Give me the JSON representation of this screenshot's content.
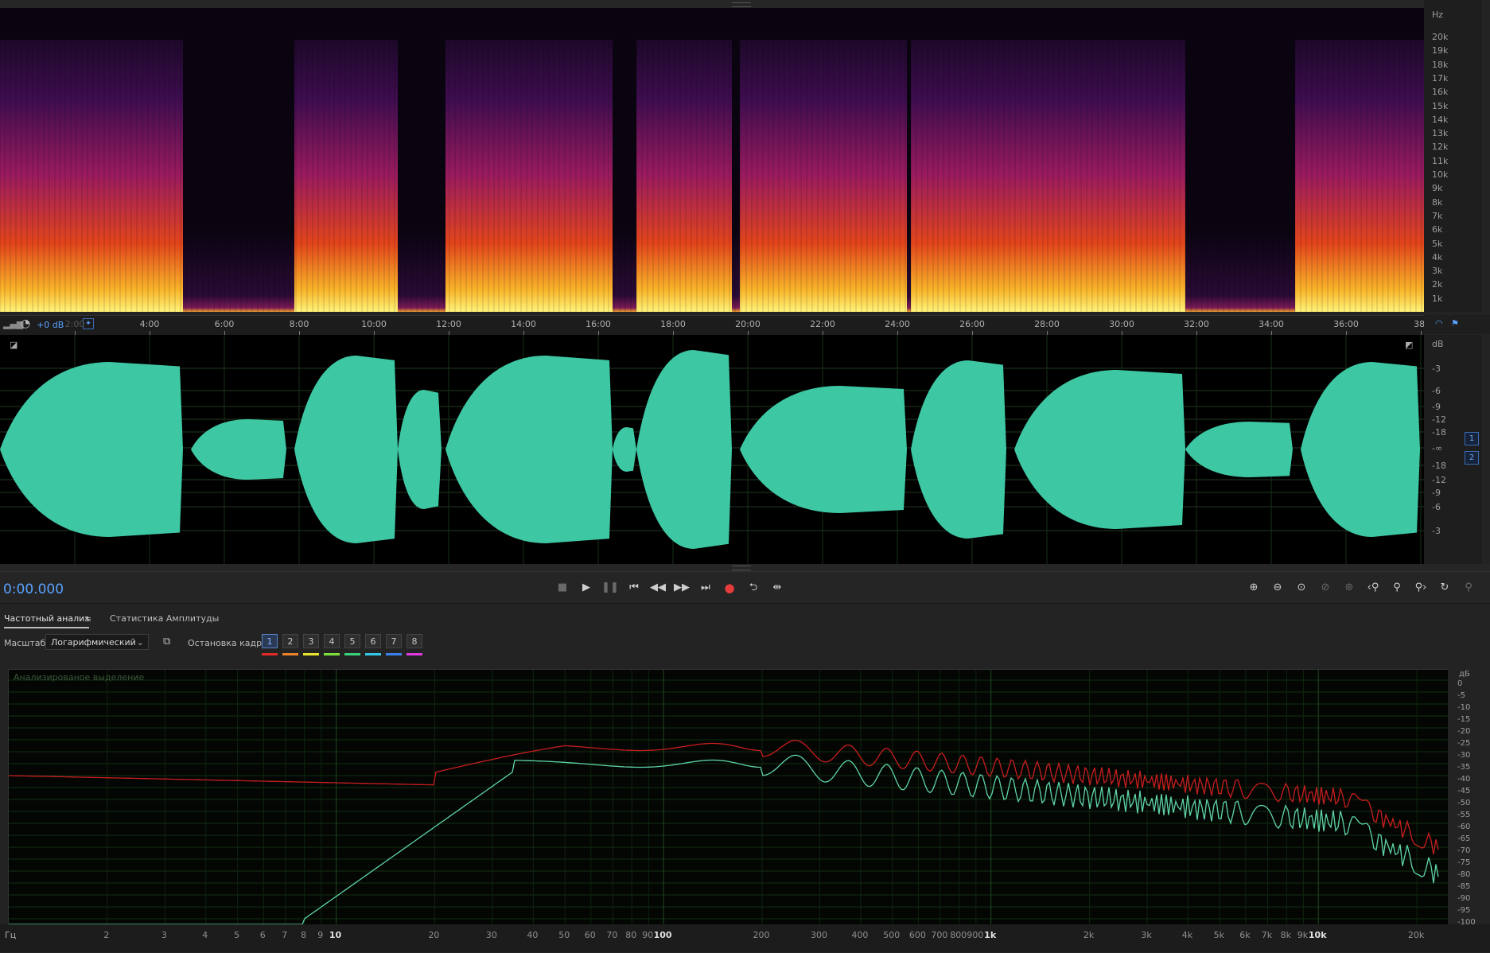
{
  "spectral": {
    "hz_unit": "Hz",
    "hz_labels": [
      "20k",
      "19k",
      "18k",
      "17k",
      "16k",
      "15k",
      "14k",
      "13k",
      "12k",
      "11k",
      "10k",
      "9k",
      "8k",
      "7k",
      "6k",
      "5k",
      "4k",
      "3k",
      "2k",
      "1k"
    ]
  },
  "ruler": {
    "gain": "+0 dB",
    "times": [
      "2:00",
      "4:00",
      "6:00",
      "8:00",
      "10:00",
      "12:00",
      "14:00",
      "16:00",
      "18:00",
      "20:00",
      "22:00",
      "24:00",
      "26:00",
      "28:00",
      "30:00",
      "32:00",
      "34:00",
      "36:00",
      "38:"
    ]
  },
  "waveform": {
    "db_unit": "dB",
    "db_labels": [
      "-3",
      "-6",
      "-9",
      "-12",
      "-18",
      "-∞",
      "-18",
      "-12",
      "-9",
      "-6",
      "-3"
    ],
    "channels": [
      "1",
      "2"
    ]
  },
  "transport": {
    "timecode": "0:00.000",
    "buttons": [
      "stop",
      "play",
      "pause",
      "go-to-start",
      "rewind",
      "fast-forward",
      "go-to-end",
      "record",
      "loop",
      "skip-selection"
    ],
    "zoom_buttons": [
      "zoom-in-amplitude",
      "zoom-out-amplitude",
      "zoom-to-fit",
      "zoom-out-full",
      "zoom-reset",
      "zoom-in-left",
      "zoom-in",
      "zoom-in-right",
      "zoom-out",
      "zoom-selection"
    ]
  },
  "panel": {
    "tab_frequency": "Частотный анализ",
    "tab_amplitude": "Статистика Амплитуды",
    "scale_label": "Масштаб:",
    "scale_value": "Логарифмический",
    "freeze_label": "Остановка кадра:",
    "frames": [
      "1",
      "2",
      "3",
      "4",
      "5",
      "6",
      "7",
      "8"
    ],
    "frame_colors": [
      "#e02b2b",
      "#e8822a",
      "#e6e22e",
      "#7de03a",
      "#3ad07a",
      "#33c7e6",
      "#3b7fe8",
      "#e03adf"
    ],
    "plot_caption": "Анализированое выделение",
    "db_unit": "дБ",
    "db_labels": [
      "0",
      "-5",
      "-10",
      "-15",
      "-20",
      "-25",
      "-30",
      "-35",
      "-40",
      "-45",
      "-50",
      "-55",
      "-60",
      "-65",
      "-70",
      "-75",
      "-80",
      "-85",
      "-90",
      "-95",
      "-100"
    ],
    "hz_unit": "Гц",
    "hz_labels": [
      "2",
      "3",
      "4",
      "5",
      "6",
      "7",
      "8",
      "9",
      "10",
      "20",
      "30",
      "40",
      "50",
      "60",
      "70",
      "80",
      "90",
      "100",
      "200",
      "300",
      "400",
      "500",
      "600",
      "700",
      "800",
      "900",
      "1k",
      "2k",
      "3k",
      "4k",
      "5k",
      "6k",
      "7k",
      "8k",
      "9k",
      "10k",
      "20k"
    ]
  },
  "colors": {
    "waveform": "#3ec7a3",
    "spectrum_red": "#c81e1e",
    "spectrum_green": "#5fd6a8",
    "timecode": "#5aa2ff"
  }
}
